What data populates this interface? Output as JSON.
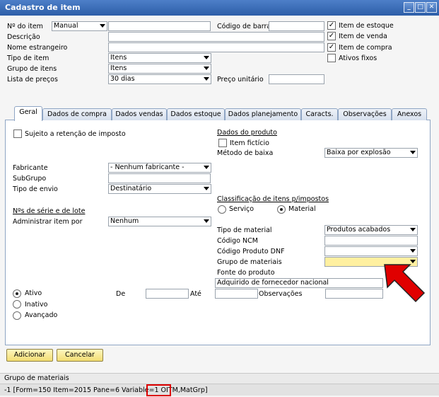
{
  "window": {
    "title": "Cadastro de item"
  },
  "header": {
    "item_no_label": "Nº do item",
    "item_no_mode": "Manual",
    "barcode_label": "Código de barra",
    "description_label": "Descrição",
    "foreign_name_label": "Nome estrangeiro",
    "item_type_label": "Tipo de item",
    "item_type_value": "Itens",
    "item_group_label": "Grupo de itens",
    "item_group_value": "Itens",
    "price_list_label": "Lista de preços",
    "price_list_value": "30 dias",
    "unit_price_label": "Preço unitário",
    "stock_item_label": "Item de estoque",
    "sales_item_label": "Item de venda",
    "purchase_item_label": "Item de compra",
    "fixed_assets_label": "Ativos fixos",
    "check_mark": "✓"
  },
  "tabs": [
    {
      "label": "Geral"
    },
    {
      "label": "Dados de compra"
    },
    {
      "label": "Dados vendas"
    },
    {
      "label": "Dados estoque"
    },
    {
      "label": "Dados planejamento"
    },
    {
      "label": "Caracts."
    },
    {
      "label": "Observações"
    },
    {
      "label": "Anexos"
    }
  ],
  "general": {
    "withholding_tax_label": "Sujeito a retenção de imposto",
    "manufacturer_label": "Fabricante",
    "manufacturer_value": "- Nenhum fabricante -",
    "subgroup_label": "SubGrupo",
    "shipping_type_label": "Tipo de envio",
    "shipping_type_value": "Destinatário",
    "serial_heading": "Nºs de série e de lote",
    "manage_item_by_label": "Administrar item por",
    "manage_item_by_value": "Nenhum",
    "product_data_heading": "Dados do produto",
    "phantom_item_label": "Item fictício",
    "issue_method_label": "Método de baixa",
    "issue_method_value": "Baixa por explosão",
    "tax_class_heading": "Classificação de itens p/impostos",
    "service_label": "Serviço",
    "material_label": "Material",
    "material_type_label": "Tipo de material",
    "material_type_value": "Produtos acabados",
    "ncm_label": "Código NCM",
    "dnf_label": "Código Produto DNF",
    "material_group_label": "Grupo de materiais",
    "product_source_label": "Fonte do produto",
    "product_source_value": "Adquirido de fornecedor nacional",
    "active_label": "Ativo",
    "inactive_label": "Inativo",
    "advanced_label": "Avançado",
    "from_label": "De",
    "to_label": "Até",
    "remarks_label": "Observações"
  },
  "buttons": {
    "add": "Adicionar",
    "cancel": "Cancelar"
  },
  "status": {
    "field_name": "Grupo de materiais",
    "info_prefix": "-1 [Form=150 Item=2015 Pane=6 Variable=1 ",
    "info_table": "OITM",
    "info_suffix": ",MatGrp]"
  },
  "colors": {
    "title_bar": "#3465b0",
    "highlight_field": "#fff0a0",
    "arrow": "#e00000",
    "highlight_box": "#dd0000"
  }
}
